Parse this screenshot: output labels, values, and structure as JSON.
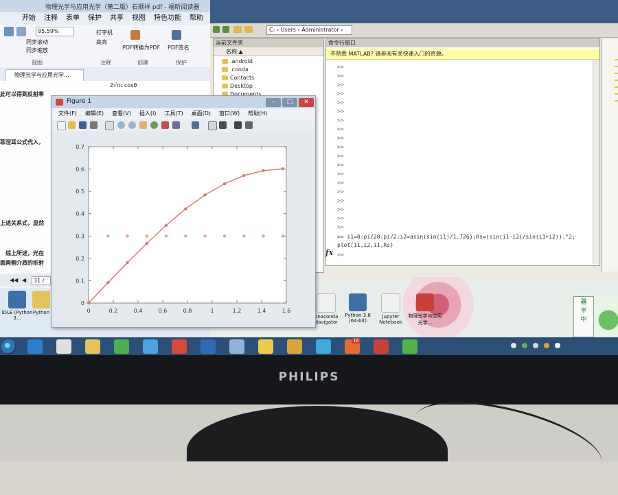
{
  "monitor": {
    "brand": "PHILIPS"
  },
  "pdf_reader": {
    "title": "物理光学与应用光学（第二版）石顺祥 pdf - 福昕阅读器",
    "menu": [
      "开始",
      "注释",
      "表单",
      "保护",
      "共享",
      "视图",
      "特色功能",
      "帮助"
    ],
    "ribbon": {
      "zoom": "95.59%",
      "buttons": [
        "同步滚动",
        "同步缩放",
        "打字机",
        "高亮",
        "PDF转换为PDF",
        "PDF签名"
      ],
      "group_labels": [
        "视图",
        "注释",
        "创建",
        "保护"
      ]
    },
    "tab": "物理光学与应用光学...",
    "page_lines": [
      "此可以得到反射率",
      "菲涅耳公式代入，",
      "上述关系式，显然",
      "综上所述，光在",
      "面两侧介质的折射"
    ],
    "formula": "2√n₂ cosθ",
    "page_number": "31 /"
  },
  "matlab": {
    "path": "C:  ›  Users  ›  Administrator  ›",
    "folder_panel_title": "当前文件夹",
    "column_header": "名称 ▲",
    "folders": [
      ".android",
      ".conda",
      "Contacts",
      "Desktop",
      "Documents"
    ],
    "command_panel_title": "命令行窗口",
    "notice": "不熟悉 MATLAB? 请参阅有关快速入门的资源。",
    "prompt": ">>",
    "prompt_rows": 19,
    "command_line_1": ">> i1=0:pi/20:pi/2;i2=asin(sin(i1)/1.726);Rs=(sin(i1-i2)/sin(i1+i2)).^2;",
    "command_line_2": "plot(i1,i2,i1,Rs)",
    "fx_label": "fx"
  },
  "figure": {
    "title": "Figure 1",
    "menu": [
      "文件(F)",
      "编辑(E)",
      "查看(V)",
      "插入(I)",
      "工具(T)",
      "桌面(D)",
      "窗口(W)",
      "帮助(H)"
    ],
    "window_buttons": [
      "–",
      "□",
      "✕"
    ]
  },
  "desktop": {
    "icons": [
      "IDLE (Python 3...",
      "Python",
      "Anaconda Navigator",
      "Python 3.6 (64-bit)",
      "Jupyter Notebook",
      "物理光学与应用光学..."
    ],
    "ime": [
      "器",
      "半",
      "中"
    ]
  },
  "taskbar": {
    "apps": [
      "start",
      "ie",
      "media",
      "explorer",
      "360-browser",
      "feishu",
      "youdao",
      "outlook",
      "mail",
      "sticky",
      "store",
      "sync",
      "matlab",
      "wps",
      "wechat"
    ],
    "badge": "16"
  },
  "chart_data": {
    "type": "line",
    "title": "",
    "xlabel": "",
    "ylabel": "",
    "xlim": [
      0,
      1.6
    ],
    "ylim": [
      0,
      0.7
    ],
    "xticks": [
      0,
      0.2,
      0.4,
      0.6,
      0.8,
      1,
      1.2,
      1.4,
      1.6
    ],
    "yticks": [
      0,
      0.1,
      0.2,
      0.3,
      0.4,
      0.5,
      0.6,
      0.7
    ],
    "grid": false,
    "series": [
      {
        "color": "#e2746f",
        "style": "solid-with-markers",
        "x": [
          0,
          0.157,
          0.314,
          0.471,
          0.628,
          0.785,
          0.942,
          1.1,
          1.257,
          1.414,
          1.571
        ],
        "y": [
          0,
          0.091,
          0.181,
          0.267,
          0.348,
          0.422,
          0.484,
          0.534,
          0.571,
          0.593,
          0.601
        ]
      },
      {
        "color": "#f09a90",
        "style": "markers",
        "x": [
          0,
          0.157,
          0.314,
          0.471,
          0.628,
          0.785,
          0.942,
          1.1,
          1.257,
          1.414,
          1.571
        ],
        "y": [
          0.3,
          0.3,
          0.3,
          0.3,
          0.3,
          0.3,
          0.3,
          0.3,
          0.3,
          0.3,
          0.3
        ]
      }
    ]
  }
}
